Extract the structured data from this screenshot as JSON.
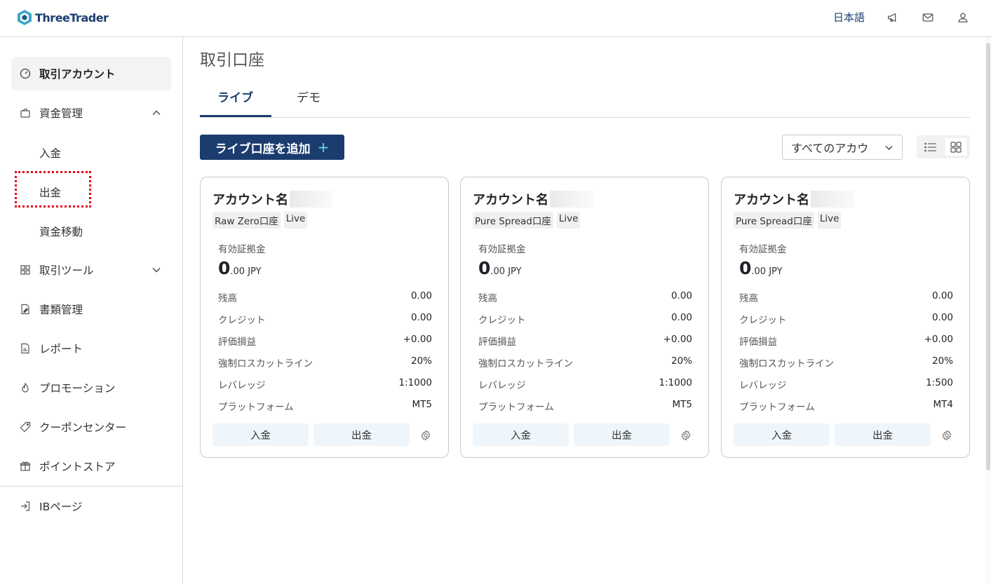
{
  "header": {
    "brand": "ThreeTrader",
    "language": "日本語",
    "icons": [
      "megaphone-icon",
      "mail-icon",
      "user-icon"
    ]
  },
  "sidebar": {
    "items": [
      {
        "label": "取引アカウント",
        "icon": "gauge-icon",
        "active": true
      },
      {
        "label": "資金管理",
        "icon": "wallet-icon",
        "expanded": true
      },
      {
        "label": "入金"
      },
      {
        "label": "出金"
      },
      {
        "label": "資金移動"
      },
      {
        "label": "取引ツール",
        "icon": "tools-icon",
        "expanded": false
      },
      {
        "label": "書類管理",
        "icon": "document-edit-icon"
      },
      {
        "label": "レポート",
        "icon": "report-icon"
      },
      {
        "label": "プロモーション",
        "icon": "flame-icon"
      },
      {
        "label": "クーポンセンター",
        "icon": "coupon-icon"
      },
      {
        "label": "ポイントストア",
        "icon": "gift-icon"
      },
      {
        "label": "IBページ",
        "icon": "login-icon"
      }
    ]
  },
  "main": {
    "title": "取引口座",
    "tabs": [
      {
        "label": "ライブ",
        "active": true
      },
      {
        "label": "デモ",
        "active": false
      }
    ],
    "add_button": "ライブ口座を追加",
    "add_plus": "+",
    "filter": {
      "selected": "すべてのアカウ"
    }
  },
  "cards": [
    {
      "title": "アカウント名",
      "tags": [
        "Raw Zero口座",
        "Live"
      ],
      "equity_label": "有効証拠金",
      "equity_int": "0",
      "equity_rest": ".00 JPY",
      "rows": [
        {
          "k": "残高",
          "v": "0.00"
        },
        {
          "k": "クレジット",
          "v": "0.00"
        },
        {
          "k": "評価損益",
          "v": "+0.00"
        },
        {
          "k": "強制ロスカットライン",
          "v": "20%"
        },
        {
          "k": "レバレッジ",
          "v": "1:1000"
        },
        {
          "k": "プラットフォーム",
          "v": "MT5"
        }
      ],
      "deposit": "入金",
      "withdraw": "出金"
    },
    {
      "title": "アカウント名",
      "tags": [
        "Pure Spread口座",
        "Live"
      ],
      "equity_label": "有効証拠金",
      "equity_int": "0",
      "equity_rest": ".00 JPY",
      "rows": [
        {
          "k": "残高",
          "v": "0.00"
        },
        {
          "k": "クレジット",
          "v": "0.00"
        },
        {
          "k": "評価損益",
          "v": "+0.00"
        },
        {
          "k": "強制ロスカットライン",
          "v": "20%"
        },
        {
          "k": "レバレッジ",
          "v": "1:1000"
        },
        {
          "k": "プラットフォーム",
          "v": "MT5"
        }
      ],
      "deposit": "入金",
      "withdraw": "出金"
    },
    {
      "title": "アカウント名",
      "tags": [
        "Pure Spread口座",
        "Live"
      ],
      "equity_label": "有効証拠金",
      "equity_int": "0",
      "equity_rest": ".00 JPY",
      "rows": [
        {
          "k": "残高",
          "v": "0.00"
        },
        {
          "k": "クレジット",
          "v": "0.00"
        },
        {
          "k": "評価損益",
          "v": "+0.00"
        },
        {
          "k": "強制ロスカットライン",
          "v": "20%"
        },
        {
          "k": "レバレッジ",
          "v": "1:500"
        },
        {
          "k": "プラットフォーム",
          "v": "MT4"
        }
      ],
      "deposit": "入金",
      "withdraw": "出金"
    }
  ],
  "colors": {
    "brand_navy": "#1b3c6e",
    "accent_cyan": "#6fd6e6",
    "highlight_red": "#e60012",
    "button_light": "#eef6fb"
  }
}
